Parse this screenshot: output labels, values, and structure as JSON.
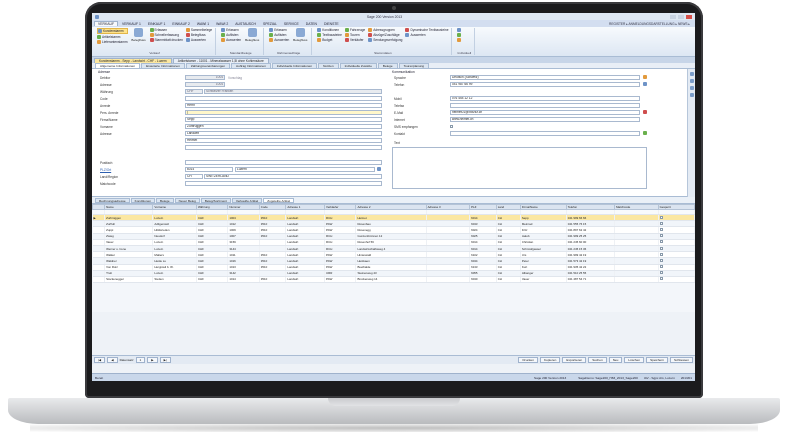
{
  "app": {
    "title": "Sage 200 Version 2013"
  },
  "menu": {
    "items": [
      "VERKAUF",
      "VERKAUF 1",
      "EINKAUF 1",
      "EINKAUF 2",
      "WAWI 1",
      "WAWI 2",
      "AUSTAUSCH",
      "SPEZIAL",
      "SERVICE",
      "DATEN",
      "DIENSTE"
    ],
    "active_index": 0,
    "right_text": "REGISTER ▸ ANMELDUNGSDARSTELLUNG ▸ NEWS ▸"
  },
  "ribbon": {
    "groups": [
      {
        "title": "Verkauf",
        "cols": [
          [
            "Kundenstamm",
            "Artikelstamm",
            "Lieferantenstamm"
          ],
          [
            "Erfassen",
            "Schnellerfassung",
            "Stammblatt drucken"
          ],
          [
            "Sammelbelege",
            "Belegfluss",
            "Auswerten"
          ]
        ],
        "big": "Belegfluss"
      },
      {
        "title": "Standardbelege",
        "cols": [
          [
            "Erfassen",
            "Auflisten",
            "Auswerten"
          ]
        ],
        "big": "Belegfluss"
      },
      {
        "title": "Rahmenaufträge",
        "cols": [
          [
            "Erfassen",
            "Auflisten",
            "Auswerten"
          ]
        ],
        "big": "Belegfluss"
      },
      {
        "title": "Stammdaten",
        "cols": [
          [
            "Konditionen",
            "Textbausteine",
            "Budget"
          ],
          [
            "Fahrzeuge",
            "Touren",
            "Verkäufer"
          ],
          [
            "Adressgruppen",
            "Abzüge/Zuschläge",
            "Sendungsverfolgung"
          ],
          [
            "Dynamische Textbausteine",
            "Auswerten"
          ]
        ]
      },
      {
        "title": "Individuell",
        "cols": [
          [
            "",
            "",
            ""
          ]
        ]
      }
    ]
  },
  "doc_tabs": [
    "Kundenstamm - Sepp - Landwirt - CHF - Luzern",
    "Artikelstamm - 11001 - Mineralwasser 1,5l ohne Kohlensäure"
  ],
  "sub_tabs": [
    "Allgemeine Informationen",
    "Erweiterte Informationen",
    "Zahlungsvereinbarungen",
    "Auftrag Informationen",
    "Individuelle Informationen",
    "Notizen",
    "Individuelle Zusätze",
    "Belege",
    "Tourenplanung"
  ],
  "form": {
    "section_adresse": "Adresse",
    "section_kommunikation": "Kommunikation",
    "labels": {
      "debitor": "Debitor",
      "adresse": "Adresse",
      "waehrung": "Währung",
      "code": "Code",
      "anrede": "Anrede",
      "pers_anrede": "Pers. Anrede",
      "firma_name": "Firma/Name",
      "vorname": "Vorname",
      "adresse2": "Adresse",
      "postfach": "Postfach",
      "plz_ort": "PLZ/Ort",
      "land_region": "Land/Region",
      "matchcode": "Matchcode",
      "sprache": "Sprache",
      "telefon": "Telefon",
      "mobil": "Mobil",
      "telefax": "Telefax",
      "email": "E-Mail",
      "internet": "Internet",
      "sms": "SMS empfangen",
      "kontakt": "Kontakt",
      "text": "Text"
    },
    "values": {
      "debitor": "1004",
      "debitor_tag": "Vorschlag",
      "adresse": "1004",
      "waehrung": "CHF",
      "waehrung_name": "Schweizer Franken",
      "code": "",
      "anrede": "Herrn",
      "pers_anrede": "|",
      "firma_name": "Sepp",
      "vorname": "Zurbrüggen",
      "adresse_line1": "Landwirt",
      "adresse_line2": "Heimet",
      "adresse_line3": "",
      "postfach": "",
      "plz": "6014",
      "ort": "Luzern",
      "land": "CH",
      "land_name": "SWITZERLAND",
      "matchcode": "",
      "sprache": "Deutsch (Schweiz)",
      "telefon": "041 987 66 99",
      "mobil": "076 454 12 12",
      "telefax": "",
      "email": "heimet01@xxxzzz.ch",
      "internet": "www.heimet.ch",
      "sms": "",
      "kontakt": ""
    }
  },
  "lower_tabs": [
    "Rechnungsadresse",
    "Konditionen",
    "Belege",
    "Neuer Beleg",
    "Beleg/Sortiment",
    "Verkaufte Artikel",
    "Zugeteilte Artikel"
  ],
  "grid": {
    "columns": [
      "",
      "Name",
      "Vorname",
      "Währung",
      "Nummer",
      "Code",
      "Adresse 1",
      "Verkäufer",
      "Adresse 2",
      "Adresse 3",
      "PLZ",
      "Land",
      "Firma/Name",
      "Telefon",
      "Matchcode",
      "Gesperrt"
    ],
    "rows": [
      [
        "▶",
        "Zurbrüggen",
        "Luzern",
        "CHF",
        "1004",
        "3510",
        "Landwirt",
        "RCH",
        "Heimet",
        "",
        "6014",
        "CH",
        "Sepp",
        "041 999 66 66",
        "",
        ""
      ],
      [
        "",
        "Zurfluh",
        "Adligenswil",
        "CHF",
        "1012",
        "3510",
        "Landwirt",
        "PAW",
        "Rosenbau",
        "",
        "6043",
        "CH",
        "Meinrad",
        "041 555 76 15",
        "",
        ""
      ],
      [
        "",
        "Zuppi",
        "Hildisrieden",
        "CHF",
        "1009",
        "3510",
        "Landwirt",
        "PAW",
        "Rosenegg",
        "",
        "6024",
        "CH",
        "Fritz",
        "041 897 62 42",
        "",
        ""
      ],
      [
        "",
        "Zwieg",
        "Neudorf",
        "CHF",
        "1007",
        "3510",
        "Landwirt",
        "RCH",
        "Gunzenbrünnen 12",
        "",
        "6025",
        "CH",
        "Jakob",
        "041 999 25 25",
        "",
        ""
      ],
      [
        "",
        "Vauer",
        "Luzern",
        "CHF",
        "3159",
        "",
        "Landwirt",
        "RCH",
        "Rosenhof 56",
        "",
        "6014",
        "CH",
        "Christian",
        "041 245 60 00",
        "",
        ""
      ],
      [
        "",
        "Werner u. Irene",
        "Luzern",
        "CHF",
        "3144",
        "",
        "Landwirt",
        "RCH",
        "Landwirtschaftsweg 4",
        "",
        "6014",
        "CH",
        "Schmid/gasser",
        "041 245 15 36",
        "",
        ""
      ],
      [
        "",
        "Walker",
        "Malters",
        "CHF",
        "1011",
        "3510",
        "Landwirt",
        "PAW",
        "Hinterwald",
        "",
        "6102",
        "CH",
        "Urs",
        "041 999 42 19",
        "",
        ""
      ],
      [
        "",
        "Waldner",
        "Heide Lu",
        "CHF",
        "1016",
        "3510",
        "Landwirt",
        "PAW",
        "Heidsaen",
        "",
        "6044",
        "CH",
        "Peter",
        "041 573 42 19",
        "",
        ""
      ],
      [
        "",
        "Von Rotz",
        "Hergiswil b. W.",
        "CHF",
        "1013",
        "3510",
        "Landwirt",
        "PAW",
        "Buelhalde",
        "",
        "6133",
        "CH",
        "Kurt",
        "041 935 42 22",
        "",
        ""
      ],
      [
        "",
        "Trutt",
        "Luzern",
        "CHF",
        "3142",
        "",
        "Landwirt",
        "URR",
        "Steinenweg 43",
        "",
        "6055",
        "CH",
        "Albanger",
        "041 510 25 55",
        "",
        ""
      ],
      [
        "",
        "Stockenegger",
        "Stetten",
        "CHF",
        "1014",
        "3510",
        "Landwirt",
        "PAW",
        "Brockenweg 14",
        "",
        "6040",
        "CH",
        "Vauer",
        "041 487 54 71",
        "",
        ""
      ]
    ],
    "selected_index": 0
  },
  "bottombar": {
    "record": "Datensatz",
    "record_num": "1",
    "buttons": [
      "Drucken",
      "Kopieren",
      "Exportieren",
      "Suchen",
      "Neu",
      "Löschen",
      "Speichern",
      "Schliessen"
    ]
  },
  "statusbar": {
    "left": "Bereit",
    "mid": "Sage 200 Version 2013",
    "right": [
      "SageDemo: Sage200_H83_2013_Sage200",
      "IAV - Sgpx AG, Luzern",
      "2013/01"
    ]
  }
}
